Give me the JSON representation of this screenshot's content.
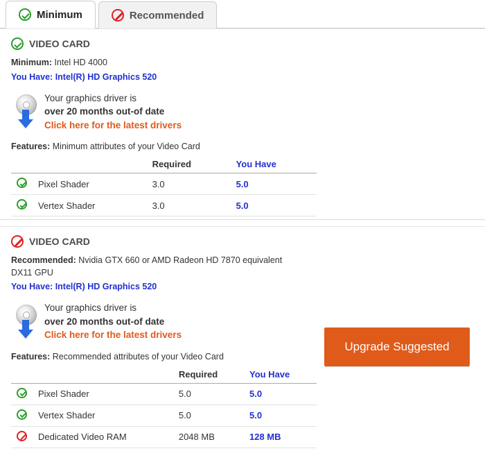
{
  "tabs": {
    "minimum": "Minimum",
    "recommended": "Recommended"
  },
  "columns": {
    "required": "Required",
    "you_have": "You Have"
  },
  "driver_notice": {
    "line1": "Your graphics driver is",
    "line2": "over 20 months out-of date",
    "link": "Click here for the latest drivers"
  },
  "you_have_gpu_prefix": "You Have:",
  "you_have_gpu": "Intel(R) HD Graphics 520",
  "upgrade_button": "Upgrade Suggested",
  "min": {
    "title": "VIDEO CARD",
    "spec_label": "Minimum:",
    "spec": "Intel HD 4000",
    "features_caption_prefix": "Features:",
    "features_caption": "Minimum attributes of your Video Card",
    "rows": [
      {
        "name": "Pixel Shader",
        "required": "3.0",
        "have": "5.0",
        "pass": true
      },
      {
        "name": "Vertex Shader",
        "required": "3.0",
        "have": "5.0",
        "pass": true
      }
    ]
  },
  "rec": {
    "title": "VIDEO CARD",
    "spec_label": "Recommended:",
    "spec": "Nvidia GTX 660 or AMD Radeon HD 7870 equivalent DX11 GPU",
    "features_caption_prefix": "Features:",
    "features_caption": "Recommended attributes of your Video Card",
    "rows": [
      {
        "name": "Pixel Shader",
        "required": "5.0",
        "have": "5.0",
        "pass": true
      },
      {
        "name": "Vertex Shader",
        "required": "5.0",
        "have": "5.0",
        "pass": true
      },
      {
        "name": "Dedicated Video RAM",
        "required": "2048 MB",
        "have": "128 MB",
        "pass": false
      }
    ]
  }
}
